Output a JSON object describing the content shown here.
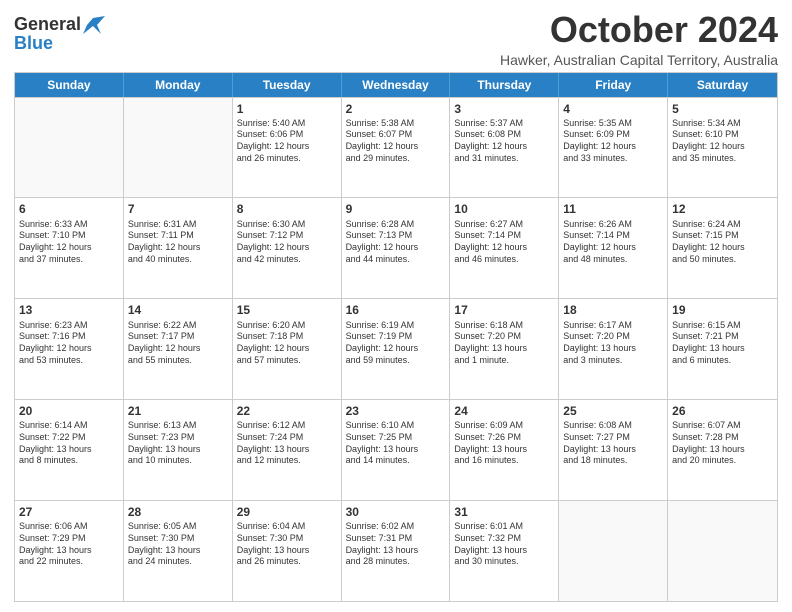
{
  "logo": {
    "general": "General",
    "blue": "Blue"
  },
  "title": "October 2024",
  "subtitle": "Hawker, Australian Capital Territory, Australia",
  "days_of_week": [
    "Sunday",
    "Monday",
    "Tuesday",
    "Wednesday",
    "Thursday",
    "Friday",
    "Saturday"
  ],
  "weeks": [
    [
      {
        "day": "",
        "info": ""
      },
      {
        "day": "",
        "info": ""
      },
      {
        "day": "1",
        "info": "Sunrise: 5:40 AM\nSunset: 6:06 PM\nDaylight: 12 hours\nand 26 minutes."
      },
      {
        "day": "2",
        "info": "Sunrise: 5:38 AM\nSunset: 6:07 PM\nDaylight: 12 hours\nand 29 minutes."
      },
      {
        "day": "3",
        "info": "Sunrise: 5:37 AM\nSunset: 6:08 PM\nDaylight: 12 hours\nand 31 minutes."
      },
      {
        "day": "4",
        "info": "Sunrise: 5:35 AM\nSunset: 6:09 PM\nDaylight: 12 hours\nand 33 minutes."
      },
      {
        "day": "5",
        "info": "Sunrise: 5:34 AM\nSunset: 6:10 PM\nDaylight: 12 hours\nand 35 minutes."
      }
    ],
    [
      {
        "day": "6",
        "info": "Sunrise: 6:33 AM\nSunset: 7:10 PM\nDaylight: 12 hours\nand 37 minutes."
      },
      {
        "day": "7",
        "info": "Sunrise: 6:31 AM\nSunset: 7:11 PM\nDaylight: 12 hours\nand 40 minutes."
      },
      {
        "day": "8",
        "info": "Sunrise: 6:30 AM\nSunset: 7:12 PM\nDaylight: 12 hours\nand 42 minutes."
      },
      {
        "day": "9",
        "info": "Sunrise: 6:28 AM\nSunset: 7:13 PM\nDaylight: 12 hours\nand 44 minutes."
      },
      {
        "day": "10",
        "info": "Sunrise: 6:27 AM\nSunset: 7:14 PM\nDaylight: 12 hours\nand 46 minutes."
      },
      {
        "day": "11",
        "info": "Sunrise: 6:26 AM\nSunset: 7:14 PM\nDaylight: 12 hours\nand 48 minutes."
      },
      {
        "day": "12",
        "info": "Sunrise: 6:24 AM\nSunset: 7:15 PM\nDaylight: 12 hours\nand 50 minutes."
      }
    ],
    [
      {
        "day": "13",
        "info": "Sunrise: 6:23 AM\nSunset: 7:16 PM\nDaylight: 12 hours\nand 53 minutes."
      },
      {
        "day": "14",
        "info": "Sunrise: 6:22 AM\nSunset: 7:17 PM\nDaylight: 12 hours\nand 55 minutes."
      },
      {
        "day": "15",
        "info": "Sunrise: 6:20 AM\nSunset: 7:18 PM\nDaylight: 12 hours\nand 57 minutes."
      },
      {
        "day": "16",
        "info": "Sunrise: 6:19 AM\nSunset: 7:19 PM\nDaylight: 12 hours\nand 59 minutes."
      },
      {
        "day": "17",
        "info": "Sunrise: 6:18 AM\nSunset: 7:20 PM\nDaylight: 13 hours\nand 1 minute."
      },
      {
        "day": "18",
        "info": "Sunrise: 6:17 AM\nSunset: 7:20 PM\nDaylight: 13 hours\nand 3 minutes."
      },
      {
        "day": "19",
        "info": "Sunrise: 6:15 AM\nSunset: 7:21 PM\nDaylight: 13 hours\nand 6 minutes."
      }
    ],
    [
      {
        "day": "20",
        "info": "Sunrise: 6:14 AM\nSunset: 7:22 PM\nDaylight: 13 hours\nand 8 minutes."
      },
      {
        "day": "21",
        "info": "Sunrise: 6:13 AM\nSunset: 7:23 PM\nDaylight: 13 hours\nand 10 minutes."
      },
      {
        "day": "22",
        "info": "Sunrise: 6:12 AM\nSunset: 7:24 PM\nDaylight: 13 hours\nand 12 minutes."
      },
      {
        "day": "23",
        "info": "Sunrise: 6:10 AM\nSunset: 7:25 PM\nDaylight: 13 hours\nand 14 minutes."
      },
      {
        "day": "24",
        "info": "Sunrise: 6:09 AM\nSunset: 7:26 PM\nDaylight: 13 hours\nand 16 minutes."
      },
      {
        "day": "25",
        "info": "Sunrise: 6:08 AM\nSunset: 7:27 PM\nDaylight: 13 hours\nand 18 minutes."
      },
      {
        "day": "26",
        "info": "Sunrise: 6:07 AM\nSunset: 7:28 PM\nDaylight: 13 hours\nand 20 minutes."
      }
    ],
    [
      {
        "day": "27",
        "info": "Sunrise: 6:06 AM\nSunset: 7:29 PM\nDaylight: 13 hours\nand 22 minutes."
      },
      {
        "day": "28",
        "info": "Sunrise: 6:05 AM\nSunset: 7:30 PM\nDaylight: 13 hours\nand 24 minutes."
      },
      {
        "day": "29",
        "info": "Sunrise: 6:04 AM\nSunset: 7:30 PM\nDaylight: 13 hours\nand 26 minutes."
      },
      {
        "day": "30",
        "info": "Sunrise: 6:02 AM\nSunset: 7:31 PM\nDaylight: 13 hours\nand 28 minutes."
      },
      {
        "day": "31",
        "info": "Sunrise: 6:01 AM\nSunset: 7:32 PM\nDaylight: 13 hours\nand 30 minutes."
      },
      {
        "day": "",
        "info": ""
      },
      {
        "day": "",
        "info": ""
      }
    ]
  ]
}
